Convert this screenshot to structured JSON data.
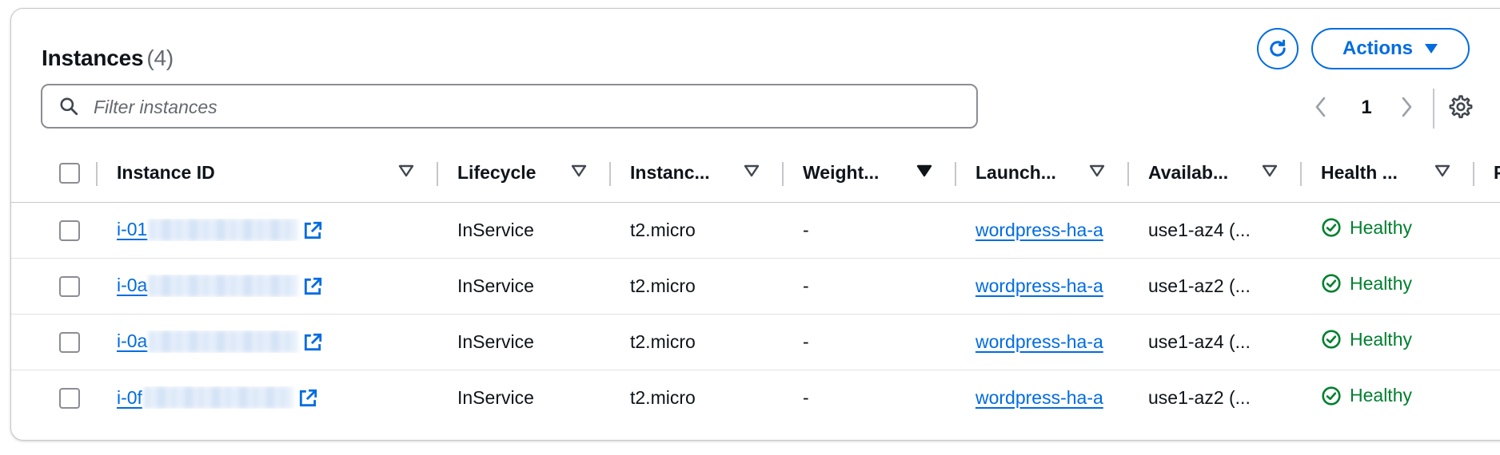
{
  "header": {
    "title": "Instances",
    "count": "(4)",
    "actions_label": "Actions"
  },
  "search": {
    "placeholder": "Filter instances",
    "value": ""
  },
  "pagination": {
    "current_page": "1"
  },
  "icons": {
    "refresh": "refresh-icon",
    "actions_caret": "caret-down-icon",
    "search": "search-icon",
    "prev": "chevron-left-icon",
    "next": "chevron-right-icon",
    "settings": "gear-icon",
    "sort": "sort-triangle-icon",
    "external": "external-link-icon",
    "healthy": "check-circle-icon"
  },
  "colors": {
    "accent": "#006ce0",
    "healthy": "#00802f",
    "text": "#0f141a",
    "muted": "#656871",
    "border": "#c6c6cd"
  },
  "table": {
    "columns": [
      {
        "label": "Instance ID",
        "sorted": false
      },
      {
        "label": "Lifecycle",
        "sorted": false
      },
      {
        "label": "Instanc...",
        "sorted": false
      },
      {
        "label": "Weight...",
        "sorted": true
      },
      {
        "label": "Launch...",
        "sorted": false
      },
      {
        "label": "Availab...",
        "sorted": false
      },
      {
        "label": "Health ...",
        "sorted": false
      },
      {
        "label": "P",
        "sorted": false
      }
    ],
    "rows": [
      {
        "instance_id": "i-01",
        "lifecycle": "InService",
        "instance_type": "t2.micro",
        "weight": "-",
        "launch": "wordpress-ha-a",
        "availability": "use1-az4 (...",
        "health": "Healthy"
      },
      {
        "instance_id": "i-0a",
        "lifecycle": "InService",
        "instance_type": "t2.micro",
        "weight": "-",
        "launch": "wordpress-ha-a",
        "availability": "use1-az2 (...",
        "health": "Healthy"
      },
      {
        "instance_id": "i-0a",
        "lifecycle": "InService",
        "instance_type": "t2.micro",
        "weight": "-",
        "launch": "wordpress-ha-a",
        "availability": "use1-az4 (...",
        "health": "Healthy"
      },
      {
        "instance_id": "i-0f",
        "lifecycle": "InService",
        "instance_type": "t2.micro",
        "weight": "-",
        "launch": "wordpress-ha-a",
        "availability": "use1-az2 (...",
        "health": "Healthy"
      }
    ]
  }
}
